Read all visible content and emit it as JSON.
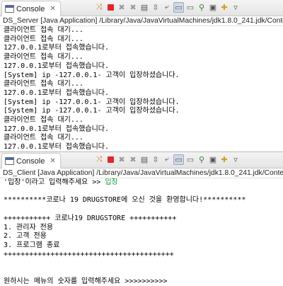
{
  "server_console": {
    "tab_label": "Console",
    "close_glyph": "✕",
    "description": "DS_Server [Java Application] /Library/Java/JavaVirtualMachines/jdk1.8.0_241.jdk/Contents/Hor",
    "lines": [
      "클라이언트 접속 대기...",
      "클라이언트 접속 대기...",
      "127.0.0.1로부터 접속했습니다.",
      "클라이언트 접속 대기...",
      "127.0.0.1로부터 접속했습니다.",
      "[System] ip -127.0.0.1- 고객이 입장하셨습니다.",
      "클라이언트 접속 대기...",
      "127.0.0.1로부터 접속했습니다.",
      "[System] ip -127.0.0.1- 고객이 입장하셨습니다.",
      "[System] ip -127.0.0.1- 고객이 입장하셨습니다.",
      "클라이언트 접속 대기...",
      "127.0.0.1로부터 접속했습니다.",
      "클라이언트 접속 대기...",
      "127.0.0.1로부터 접속했습니다.",
      "[System] ip -127.0.0.1- 고객이 입장하셨습니다."
    ]
  },
  "client_console": {
    "tab_label": "Console",
    "close_glyph": "✕",
    "description": "DS_Client [Java Application] /Library/Java/JavaVirtualMachines/jdk1.8.0_241.jdk/Contents/Hor",
    "prompt_prefix": "'입장'이라고 입력해주세요 >> ",
    "prompt_input": "입장",
    "lines": [
      "",
      "**********코로나 19 DRUGSTORE에 오신 것을 환영합니다!**********",
      "",
      "+++++++++++ 코로나19 DRUGSTORE +++++++++++",
      "1. 관리자 전용",
      "2. 고객 전용",
      "3. 프로그램 종료",
      "++++++++++++++++++++++++++++++++++++++++",
      "",
      "",
      "원하시는 메뉴의 숫자를 입력해주세요 >>>>>>>>>>"
    ]
  },
  "toolbar_icons": [
    "terminate-all-icon",
    "stop-icon",
    "remove-launch-icon",
    "remove-all-icon",
    "clear-console-icon",
    "scroll-lock-icon",
    "word-wrap-icon",
    "show-on-output-icon",
    "show-on-error-icon",
    "pin-console-icon",
    "display-console-icon",
    "open-console-icon",
    "view-menu-icon"
  ]
}
